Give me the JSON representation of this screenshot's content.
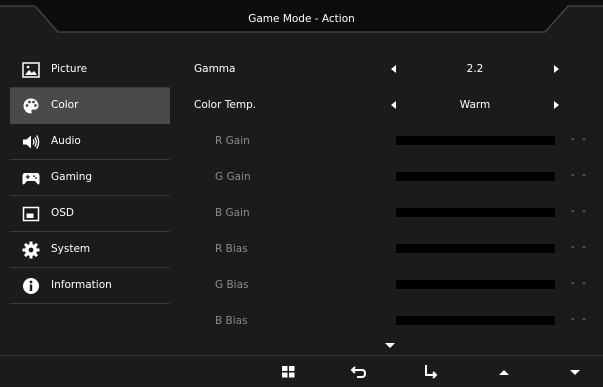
{
  "header": {
    "title": "Game Mode - Action"
  },
  "sidebar": {
    "items": [
      {
        "label": "Picture",
        "icon": "picture-icon",
        "active": false
      },
      {
        "label": "Color",
        "icon": "palette-icon",
        "active": true
      },
      {
        "label": "Audio",
        "icon": "speaker-icon",
        "active": false
      },
      {
        "label": "Gaming",
        "icon": "gamepad-icon",
        "active": false
      },
      {
        "label": "OSD",
        "icon": "osd-icon",
        "active": false
      },
      {
        "label": "System",
        "icon": "gear-icon",
        "active": false
      },
      {
        "label": "Information",
        "icon": "info-icon",
        "active": false
      }
    ]
  },
  "settings": {
    "gamma": {
      "label": "Gamma",
      "value": "2.2"
    },
    "color_temp": {
      "label": "Color Temp.",
      "value": "Warm"
    },
    "sliders": [
      {
        "label": "R Gain",
        "value": "- -"
      },
      {
        "label": "G Gain",
        "value": "- -"
      },
      {
        "label": "B Gain",
        "value": "- -"
      },
      {
        "label": "R Bias",
        "value": "- -"
      },
      {
        "label": "G Bias",
        "value": "- -"
      },
      {
        "label": "B Bias",
        "value": "- -"
      }
    ]
  },
  "footer": {
    "buttons": [
      "menu-grid-icon",
      "back-icon",
      "enter-icon",
      "up-icon",
      "down-icon"
    ]
  },
  "colors": {
    "background": "#1b1b1b",
    "active_item": "#4a4a4a",
    "disabled_text": "#8c8c8c",
    "bar": "#000000"
  }
}
